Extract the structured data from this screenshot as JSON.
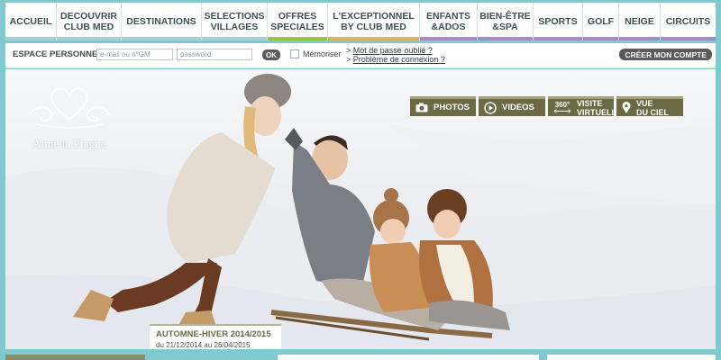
{
  "nav": {
    "items": [
      {
        "label": "ACCUEIL",
        "underline": "#a9cfd3"
      },
      {
        "label": "DECOUVRIR\nCLUB MED",
        "underline": "#a9cfd3"
      },
      {
        "label": "DESTINATIONS",
        "underline": "#a9cfd3"
      },
      {
        "label": "SELECTIONS\nVILLAGES",
        "underline": "#a9cfd3"
      },
      {
        "label": "OFFRES\nSPECIALES",
        "underline": "#9ac24b"
      },
      {
        "label": "L'EXCEPTIONNEL\nBY CLUB MED",
        "underline": "#d9b36c"
      },
      {
        "label": "ENFANTS\n&ADOS",
        "underline": "#9d8fc8"
      },
      {
        "label": "BIEN-ÊTRE\n&SPA",
        "underline": "#9d8fc8"
      },
      {
        "label": "SPORTS",
        "underline": "#9d8fc8"
      },
      {
        "label": "GOLF",
        "underline": "#9d8fc8"
      },
      {
        "label": "NEIGE",
        "underline": "#9d8fc8"
      },
      {
        "label": "CIRCUITS",
        "underline": "#9d8fc8"
      }
    ]
  },
  "espace": {
    "label": "ESPACE PERSONNEL",
    "email_placeholder": "e-mail ou n°GM",
    "password_placeholder": "password",
    "ok_label": "OK",
    "remember_label": "Mémoriser",
    "forgot_label": "Mot de passe oublié ?",
    "connection_problem_label": "Problème de connexion ?",
    "link_bullet": ">",
    "create_account_label": "CRÉER MON COMPTE"
  },
  "hero": {
    "logo_text": "Aime la Plagne",
    "media_buttons": [
      {
        "icon": "camera-icon",
        "label": "PHOTOS"
      },
      {
        "icon": "play-icon",
        "label": "VIDEOS"
      },
      {
        "icon": "360-icon",
        "label": "VISITE\nVIRTUELLE",
        "badge": "360°"
      },
      {
        "icon": "location-pin-icon",
        "label": "VUE\nDU CIEL"
      }
    ],
    "season": {
      "title": "AUTOMNE-HIVER 2014/2015",
      "dates": "du 21/12/2014 au 26/04/2015"
    }
  },
  "colors": {
    "frame": "#7fc9cf",
    "media_button": "#6b6a44",
    "season_title": "#6b6a44"
  }
}
